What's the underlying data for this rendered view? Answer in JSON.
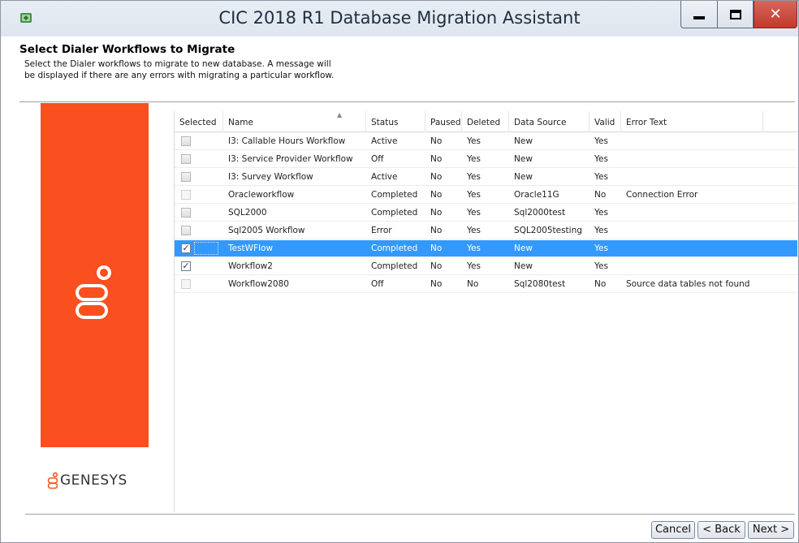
{
  "window": {
    "title": "CIC 2018 R1 Database Migration Assistant",
    "controls": {
      "minimize": "minimize-icon",
      "maximize": "maximize-icon",
      "close": "✕"
    }
  },
  "header": {
    "title": "Select Dialer Workflows to Migrate",
    "description": "Select the Dialer workflows to migrate to new database. A message will be displayed if there are any errors with migrating a particular workflow."
  },
  "banner": {
    "brand": "GENESYS",
    "color": "#fa4f1f"
  },
  "table": {
    "columns": [
      "Selected",
      "Name",
      "Status",
      "Paused",
      "Deleted",
      "Data Source",
      "Valid",
      "Error Text"
    ],
    "rows": [
      {
        "checked": false,
        "dim": false,
        "name": "I3: Callable Hours Workflow",
        "status": "Active",
        "paused": "No",
        "deleted": "Yes",
        "source": "New",
        "valid": "Yes",
        "error": ""
      },
      {
        "checked": false,
        "dim": false,
        "name": "I3: Service Provider Workflow",
        "status": "Off",
        "paused": "No",
        "deleted": "Yes",
        "source": "New",
        "valid": "Yes",
        "error": ""
      },
      {
        "checked": false,
        "dim": false,
        "name": "I3: Survey Workflow",
        "status": "Active",
        "paused": "No",
        "deleted": "Yes",
        "source": "New",
        "valid": "Yes",
        "error": ""
      },
      {
        "checked": false,
        "dim": true,
        "name": "Oracleworkflow",
        "status": "Completed",
        "paused": "No",
        "deleted": "Yes",
        "source": "Oracle11G",
        "valid": "No",
        "error": "Connection Error"
      },
      {
        "checked": false,
        "dim": false,
        "name": "SQL2000",
        "status": "Completed",
        "paused": "No",
        "deleted": "Yes",
        "source": "Sql2000test",
        "valid": "Yes",
        "error": ""
      },
      {
        "checked": false,
        "dim": false,
        "name": "Sql2005 Workflow",
        "status": "Error",
        "paused": "No",
        "deleted": "Yes",
        "source": "SQL2005testing",
        "valid": "Yes",
        "error": ""
      },
      {
        "checked": true,
        "dim": false,
        "selected": true,
        "name": "TestWFlow",
        "status": "Completed",
        "paused": "No",
        "deleted": "Yes",
        "source": "New",
        "valid": "Yes",
        "error": ""
      },
      {
        "checked": true,
        "dim": false,
        "name": "Workflow2",
        "status": "Completed",
        "paused": "No",
        "deleted": "Yes",
        "source": "New",
        "valid": "Yes",
        "error": ""
      },
      {
        "checked": false,
        "dim": true,
        "name": "Workflow2080",
        "status": "Off",
        "paused": "No",
        "deleted": "No",
        "source": "Sql2080test",
        "valid": "No",
        "error": "Source data tables not found"
      }
    ]
  },
  "footer": {
    "cancel": "Cancel",
    "back": "< Back",
    "next": "Next >"
  },
  "colors": {
    "selection": "#3399ff",
    "close_button": "#c2392b"
  }
}
